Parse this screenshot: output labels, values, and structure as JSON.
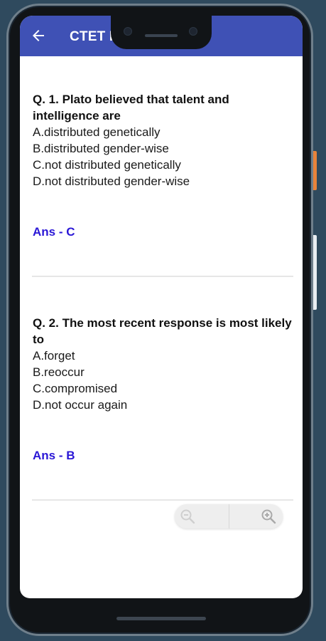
{
  "app": {
    "title": "CTET P"
  },
  "icons": {
    "back": "arrow-left-icon",
    "zoom_out": "zoom-out-icon",
    "zoom_in": "zoom-in-icon"
  },
  "colors": {
    "appbar": "#3f51b5",
    "answer": "#2a17d6",
    "background": "#2f4a5e"
  },
  "questions": [
    {
      "text": "Q. 1. Plato believed that talent and intelligence are",
      "options": [
        "A.distributed genetically",
        "B.distributed gender-wise",
        "C.not distributed genetically",
        "D.not distributed gender-wise"
      ],
      "answer": "Ans - C"
    },
    {
      "text": "Q. 2. The most recent response is most likely to",
      "options": [
        "A.forget",
        "B.reoccur",
        "C.compromised",
        "D.not occur again"
      ],
      "answer": "Ans - B"
    }
  ]
}
